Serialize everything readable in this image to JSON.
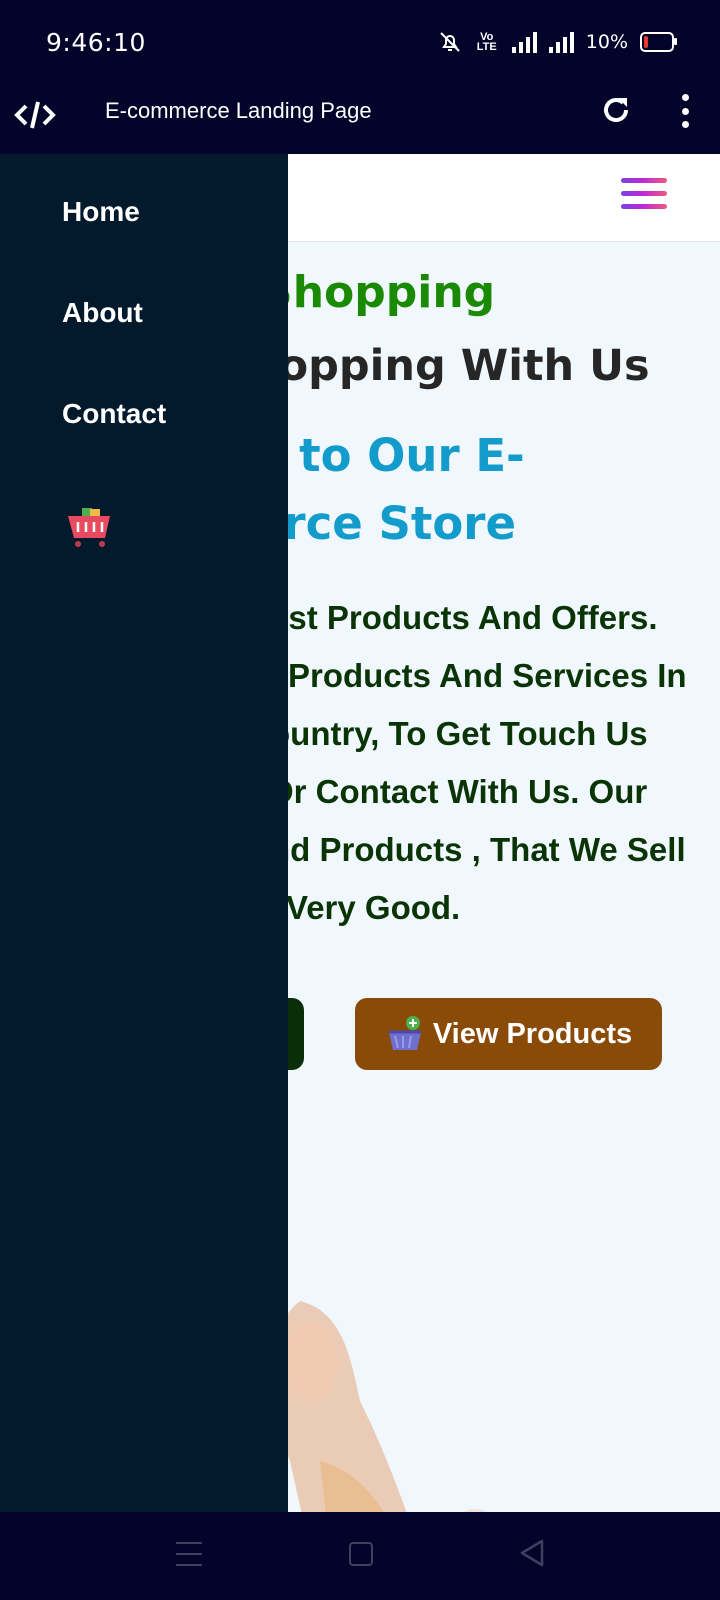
{
  "status_bar": {
    "time": "9:46:10",
    "battery_text": "10%"
  },
  "app_bar": {
    "title": "E-commerce Landing Page"
  },
  "drawer": {
    "items": [
      {
        "label": "Home"
      },
      {
        "label": "About"
      },
      {
        "label": "Contact"
      }
    ],
    "cart_icon": "shopping-cart-icon"
  },
  "hero": {
    "tagline": "y Shopping",
    "subheading": "Shopping With Us",
    "welcome_line1": "me to Our E-",
    "welcome_line2": "merce Store",
    "body_lines": [
      "est Products And Offers.",
      " Products And Services In",
      "ountry, To Get Touch Us",
      "Or Contact With Us. Our",
      "nd Products , That We Sell",
      "Very Good."
    ],
    "view_products_label": "View Products"
  },
  "colors": {
    "drawer_bg": "#021a2b",
    "tagline": "#1a8a05",
    "welcome": "#129bcb",
    "body_text": "#0a3406",
    "view_products_bg": "#8a4a08"
  }
}
